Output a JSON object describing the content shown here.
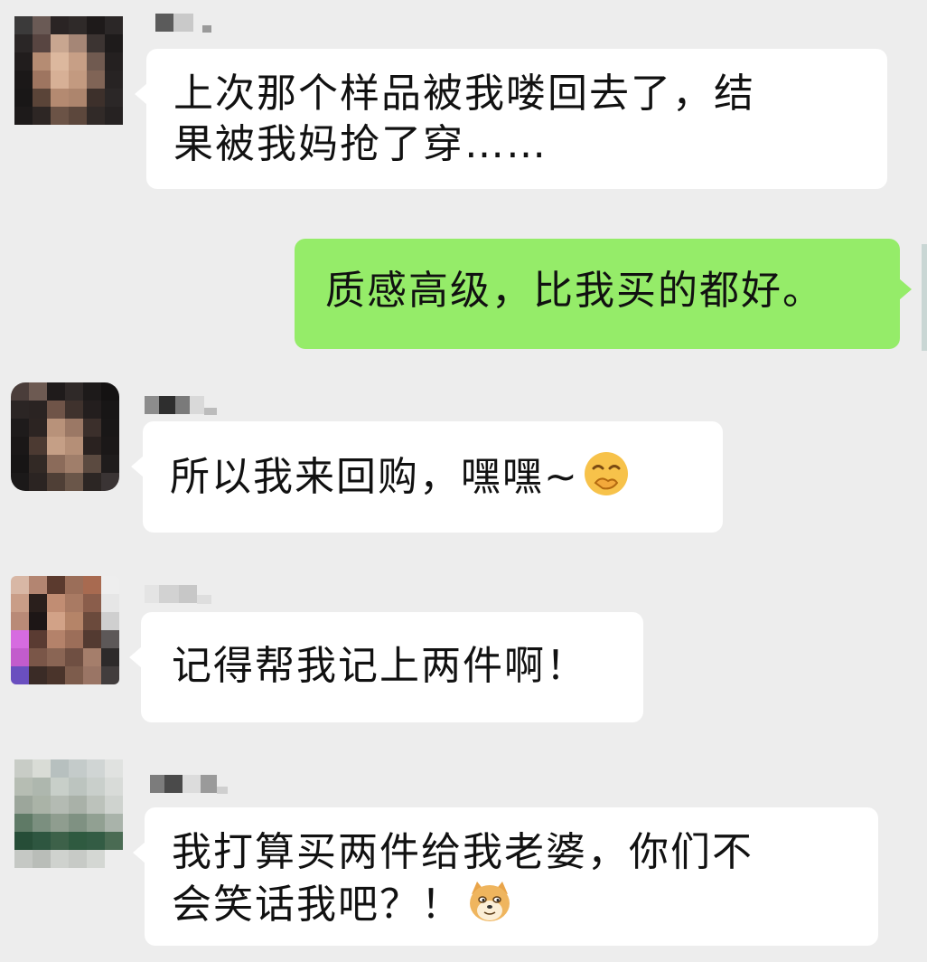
{
  "chat": {
    "messages": [
      {
        "side": "left",
        "sender_visible": "群姐",
        "lines": [
          "上次那个样品被我喽回去了，结",
          "果被我妈抢了穿……"
        ],
        "emoji": ""
      },
      {
        "side": "right",
        "sender_visible": "",
        "lines": [
          "质感高级，比我买的都好。"
        ],
        "emoji": ""
      },
      {
        "side": "left",
        "sender_visible": "姐",
        "lines": [
          "所以我来回购，嘿嘿~"
        ],
        "emoji": "covering-mouth-smile-icon"
      },
      {
        "side": "left",
        "sender_visible": "",
        "lines": [
          "记得帮我记上两件啊！"
        ],
        "emoji": ""
      },
      {
        "side": "left",
        "sender_visible": "",
        "lines": [
          "我打算买两件给我老婆，你们不",
          "会笑话我吧？！"
        ],
        "emoji": "doge-icon"
      }
    ]
  },
  "colors": {
    "background": "#ededed",
    "incoming_bubble": "#ffffff",
    "outgoing_bubble": "#95ec69",
    "text": "#111111"
  }
}
